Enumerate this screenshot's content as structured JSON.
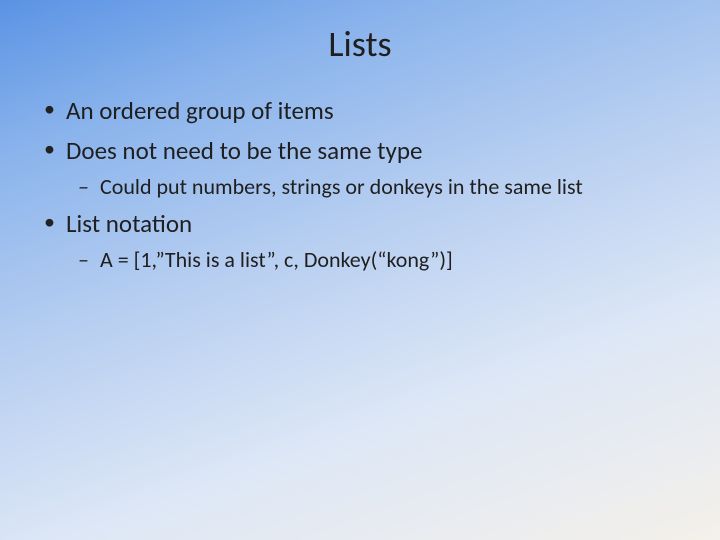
{
  "title": "Lists",
  "bullets": [
    {
      "text": "An ordered group of items",
      "sub": []
    },
    {
      "text": "Does not need to be the same type",
      "sub": [
        "Could put numbers, strings or donkeys in the same list"
      ]
    },
    {
      "text": "List notation",
      "sub": [
        "A = [1,”This is a list”, c, Donkey(“kong”)]"
      ]
    }
  ]
}
